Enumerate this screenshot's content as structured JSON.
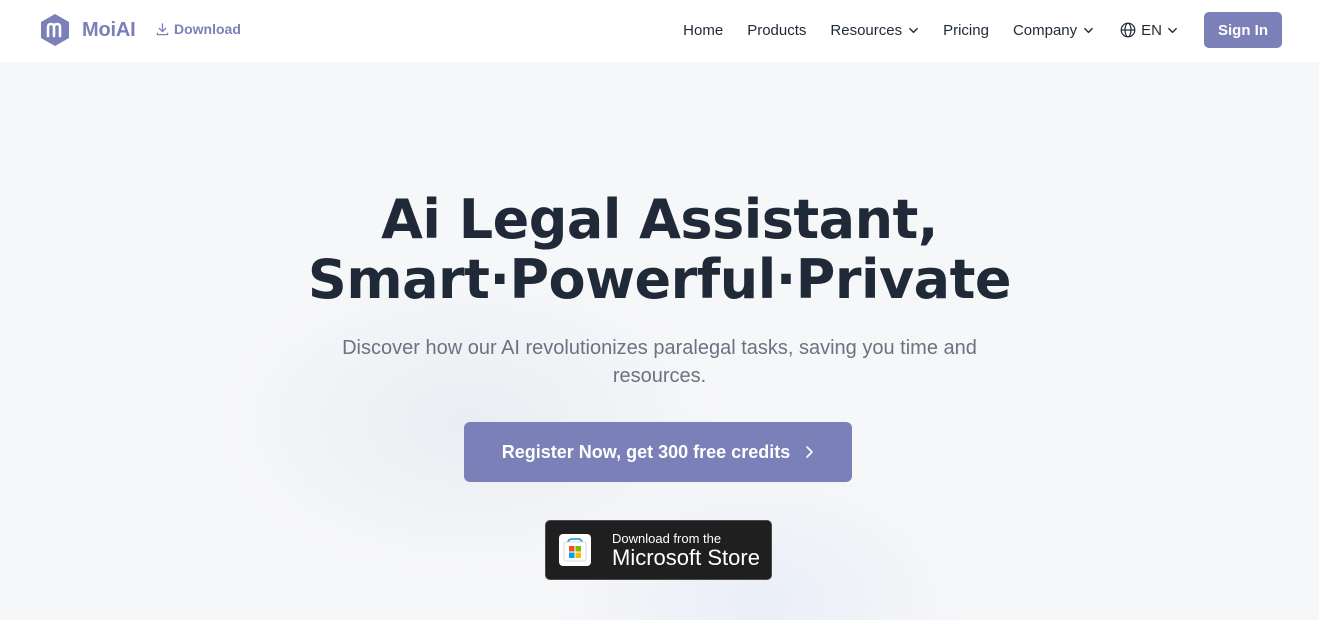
{
  "nav": {
    "brand_name": "MoiAI",
    "download_label": "Download",
    "items": [
      {
        "label": "Home"
      },
      {
        "label": "Products"
      },
      {
        "label": "Resources"
      },
      {
        "label": "Pricing"
      },
      {
        "label": "Company"
      }
    ],
    "language": "EN",
    "sign_in_label": "Sign In"
  },
  "hero": {
    "headline_line1": "Ai Legal Assistant,",
    "headline_line2": "Smart·Powerful·Private",
    "subtitle": "Discover how our AI revolutionizes paralegal tasks, saving you time and resources.",
    "cta_label": "Register Now, get 300 free credits",
    "store_badge": {
      "small": "Download from the",
      "large": "Microsoft Store"
    }
  },
  "colors": {
    "accent": "#7b80b8",
    "text_dark": "#1f2937",
    "text_muted": "#6b7280",
    "background": "#f6f7f9"
  },
  "icons": {
    "logo": "moiai-logo-icon",
    "download": "download-icon",
    "chevron": "chevron-down-icon",
    "globe": "globe-icon",
    "cta_arrow": "chevron-right-icon",
    "store": "microsoft-store-icon"
  }
}
